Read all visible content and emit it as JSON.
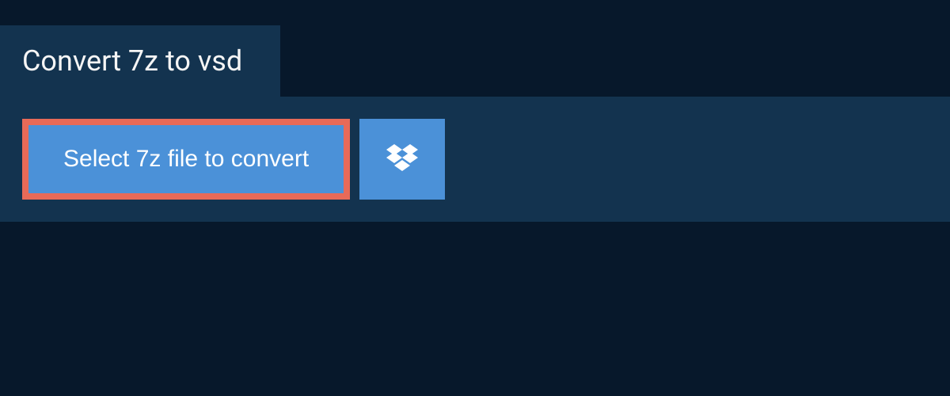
{
  "tab": {
    "title": "Convert 7z to vsd"
  },
  "actions": {
    "select_file_label": "Select 7z file to convert"
  },
  "colors": {
    "background": "#07182b",
    "panel": "#13334f",
    "button": "#4b91d8",
    "highlight_border": "#e86a58"
  }
}
